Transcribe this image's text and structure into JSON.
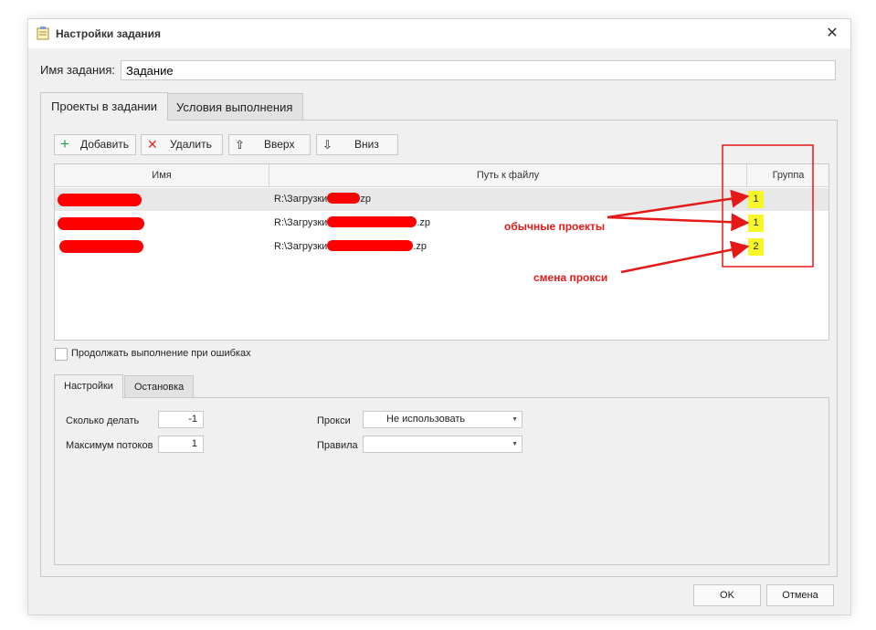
{
  "window": {
    "title": "Настройки задания"
  },
  "task_name": {
    "label": "Имя задания:",
    "value": "Задание"
  },
  "main_tabs": [
    {
      "label": "Проекты в задании",
      "active": true
    },
    {
      "label": "Условия выполнения",
      "active": false
    }
  ],
  "toolbar": {
    "add_label": "Добавить",
    "delete_label": "Удалить",
    "up_label": "Вверх",
    "down_label": "Вниз"
  },
  "grid": {
    "columns": [
      "Имя",
      "Путь к файлу",
      "Группа"
    ],
    "rows": [
      {
        "name": "",
        "path_prefix": "R:\\Загрузки",
        "path_suffix": "zp",
        "group": "1",
        "selected": true
      },
      {
        "name": "",
        "path_prefix": "R:\\Загрузки",
        "path_suffix": ".zp",
        "group": "1",
        "selected": false
      },
      {
        "name": "",
        "path_prefix": "R:\\Загрузки",
        "path_suffix": ".zp",
        "group": "2",
        "selected": false
      }
    ]
  },
  "continue_on_error": {
    "label": "Продолжать выполнение при ошибках",
    "checked": false
  },
  "sub_tabs": [
    {
      "label": "Настройки",
      "active": true
    },
    {
      "label": "Остановка",
      "active": false
    }
  ],
  "settings": {
    "how_many_label": "Сколько делать",
    "how_many_value": "-1",
    "max_threads_label": "Максимум потоков",
    "max_threads_value": "1",
    "proxy_label": "Прокси",
    "proxy_value": "Не использовать",
    "rules_label": "Правила",
    "rules_value": ""
  },
  "buttons": {
    "ok_label": "OK",
    "cancel_label": "Отмена"
  },
  "annotations": {
    "regular_projects": "обычные проекты",
    "proxy_change": "смена прокси",
    "color": "#e61919"
  },
  "colors": {
    "highlight": "#f6f628",
    "redaction": "#ff0000"
  }
}
